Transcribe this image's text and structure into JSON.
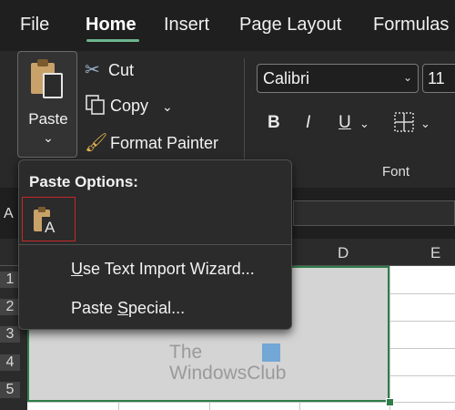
{
  "menu": {
    "tabs": [
      {
        "label": "File"
      },
      {
        "label": "Home"
      },
      {
        "label": "Insert"
      },
      {
        "label": "Page Layout"
      },
      {
        "label": "Formulas"
      }
    ],
    "active_tab": "Home",
    "accent_color": "#6fb58f"
  },
  "clipboard": {
    "paste_label": "Paste",
    "cut_label": "Cut",
    "copy_label": "Copy",
    "format_painter_label": "Format Painter"
  },
  "font": {
    "font_name": "Calibri",
    "font_size": "11",
    "bold": "B",
    "italic": "I",
    "underline": "U",
    "group_label": "Font"
  },
  "name_box": {
    "partial_text": "A"
  },
  "grid": {
    "column_headers": [
      "D",
      "E"
    ],
    "row_numbers": [
      "1",
      "2",
      "3",
      "4",
      "5"
    ],
    "selection_color": "#2e7d4a"
  },
  "paste_menu": {
    "title": "Paste Options:",
    "items": [
      {
        "prefix": "",
        "accel": "U",
        "rest": "se Text Import Wizard..."
      },
      {
        "prefix": "Paste ",
        "accel": "S",
        "rest": "pecial..."
      }
    ],
    "highlight_color": "#c62828"
  },
  "watermark": {
    "line1": "The",
    "line2": "WindowsClub"
  }
}
